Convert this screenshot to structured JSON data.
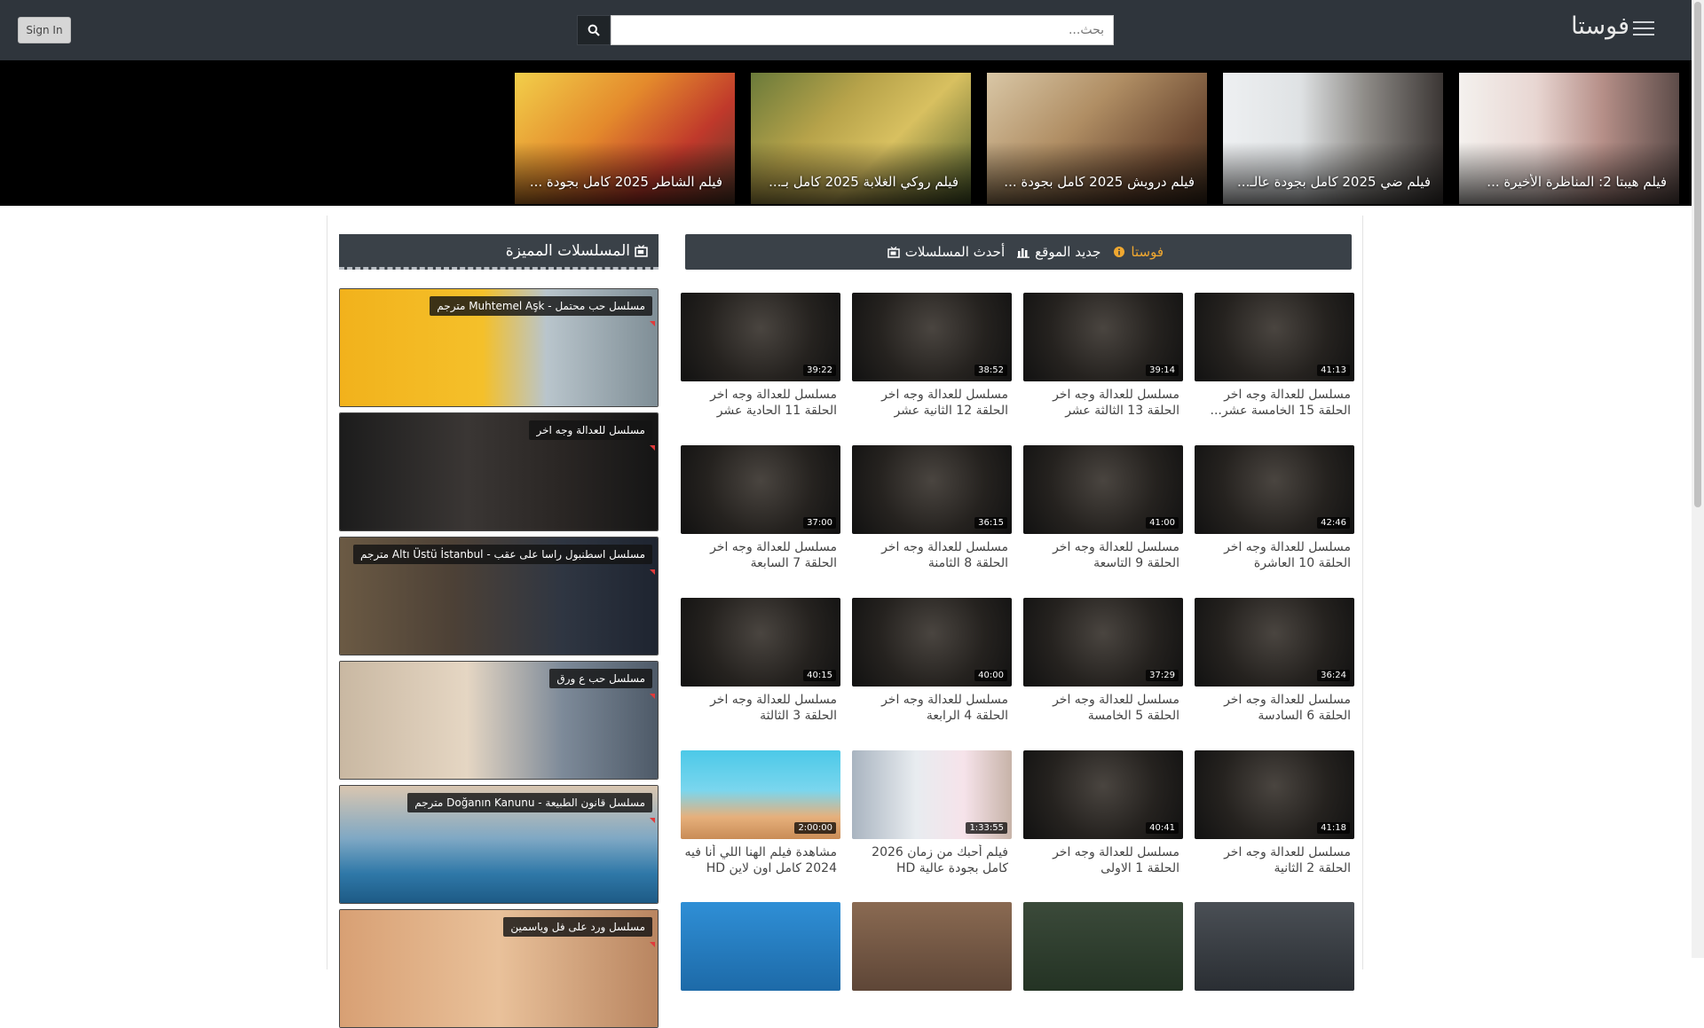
{
  "header": {
    "signin_label": "Sign In",
    "search_placeholder": "بحث...",
    "brand": "فوستا"
  },
  "slider": [
    {
      "title": "فيلم الشاطر 2025 كامل بجودة ..."
    },
    {
      "title": "فيلم روكي الغلابة 2025 كامل بـ..."
    },
    {
      "title": "فيلم درويش 2025 كامل بجودة ..."
    },
    {
      "title": "فيلم ضي 2025 كامل بجودة عالـ..."
    },
    {
      "title": "فيلم هيبتا 2: المناظرة الأخيرة ..."
    }
  ],
  "tabs": [
    {
      "label": "فوستا",
      "icon": "info-icon",
      "active": true
    },
    {
      "label": "جديد الموقع",
      "icon": "chart-icon",
      "active": false
    },
    {
      "label": "أحدث المسلسلات",
      "icon": "tv-icon",
      "active": false
    }
  ],
  "sidebar": {
    "title": "المسلسلات المميزة",
    "items": [
      {
        "label": "مسلسل حب محتمل - Muhtemel Aşk مترجم"
      },
      {
        "label": "مسلسل للعدالة وجه اخر"
      },
      {
        "label": "مسلسل اسطنبول راسا على عقب - Altı Üstü İstanbul مترجم"
      },
      {
        "label": "مسلسل حب ع ورق"
      },
      {
        "label": "مسلسل قانون الطبيعة - Doğanın Kanunu مترجم"
      },
      {
        "label": "مسلسل ورد على فل وياسمين"
      }
    ]
  },
  "grid": {
    "rows": [
      [
        {
          "title": "مسلسل للعدالة وجه اخر الحلقة 15 الخامسة عشر...",
          "duration": "41:13"
        },
        {
          "title": "مسلسل للعدالة وجه اخر الحلقة 13 الثالثة عشر",
          "duration": "39:14"
        },
        {
          "title": "مسلسل للعدالة وجه اخر الحلقة 12 الثانية عشر",
          "duration": "38:52"
        },
        {
          "title": "مسلسل للعدالة وجه اخر الحلقة 11 الحادية عشر",
          "duration": "39:22"
        }
      ],
      [
        {
          "title": "مسلسل للعدالة وجه اخر الحلقة 10 العاشرة",
          "duration": "42:46"
        },
        {
          "title": "مسلسل للعدالة وجه اخر الحلقة 9 التاسعة",
          "duration": "41:00"
        },
        {
          "title": "مسلسل للعدالة وجه اخر الحلقة 8 الثامنة",
          "duration": "36:15"
        },
        {
          "title": "مسلسل للعدالة وجه اخر الحلقة 7 السابعة",
          "duration": "37:00"
        }
      ],
      [
        {
          "title": "مسلسل للعدالة وجه اخر الحلقة 6 السادسة",
          "duration": "36:24"
        },
        {
          "title": "مسلسل للعدالة وجه اخر الحلقة 5 الخامسة",
          "duration": "37:29"
        },
        {
          "title": "مسلسل للعدالة وجه اخر الحلقة 4 الرابعة",
          "duration": "40:00"
        },
        {
          "title": "مسلسل للعدالة وجه اخر الحلقة 3 الثالثة",
          "duration": "40:15"
        }
      ],
      [
        {
          "title": "مسلسل للعدالة وجه اخر الحلقة 2 الثانية",
          "duration": "41:18"
        },
        {
          "title": "مسلسل للعدالة وجه اخر الحلقة 1 الاولى",
          "duration": "40:41"
        },
        {
          "title": "فيلم أحبك من زمان 2026 كامل بجودة عالية HD",
          "duration": "1:33:55"
        },
        {
          "title": "مشاهدة فيلم الهنا اللي أنا فيه 2024 كامل اون لاين HD",
          "duration": "2:00:00"
        }
      ]
    ]
  },
  "colors": {
    "header_bg": "#2f353c",
    "bar_bg": "#3a4148",
    "active_tab": "#f0a830"
  }
}
